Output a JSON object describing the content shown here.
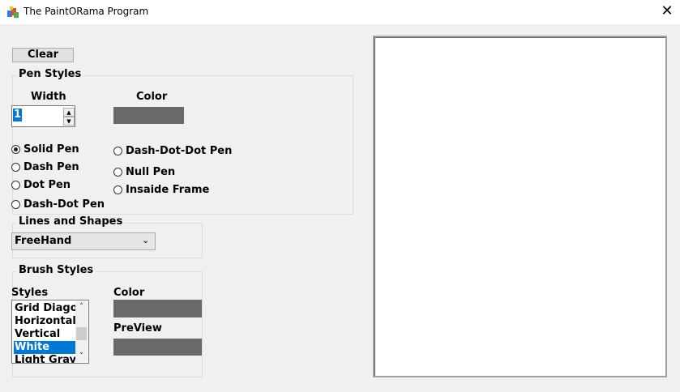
{
  "window": {
    "title": "The PaintORama Program",
    "close_glyph": "✕"
  },
  "toolbar": {
    "clear_label": "Clear"
  },
  "pen_styles": {
    "group_label": "Pen Styles",
    "width_label": "Width",
    "width_value": "1",
    "color_label": "Color",
    "color_value": "#696969",
    "options": [
      {
        "label": "Solid Pen",
        "selected": true
      },
      {
        "label": "Dash Pen",
        "selected": false
      },
      {
        "label": "Dot Pen",
        "selected": false
      },
      {
        "label": "Dash-Dot Pen",
        "selected": false
      },
      {
        "label": "Dash-Dot-Dot Pen",
        "selected": false
      },
      {
        "label": "Null Pen",
        "selected": false
      },
      {
        "label": "Insaide Frame",
        "selected": false
      }
    ]
  },
  "lines_shapes": {
    "group_label": "Lines and Shapes",
    "selected": "FreeHand"
  },
  "brush_styles": {
    "group_label": "Brush Styles",
    "styles_label": "Styles",
    "styles_items": [
      "Grid Diagor",
      "Horizontal",
      "Vertical",
      "White",
      "Light Gray"
    ],
    "styles_selected": "White",
    "color_label": "Color",
    "color_value": "#696969",
    "preview_label": "PreView",
    "preview_value": "#696969"
  },
  "icons": {
    "app": "paint-palette-icon",
    "close": "close-icon",
    "spin_up": "chevron-up-icon",
    "spin_down": "chevron-down-icon",
    "combo": "chevron-down-icon"
  }
}
